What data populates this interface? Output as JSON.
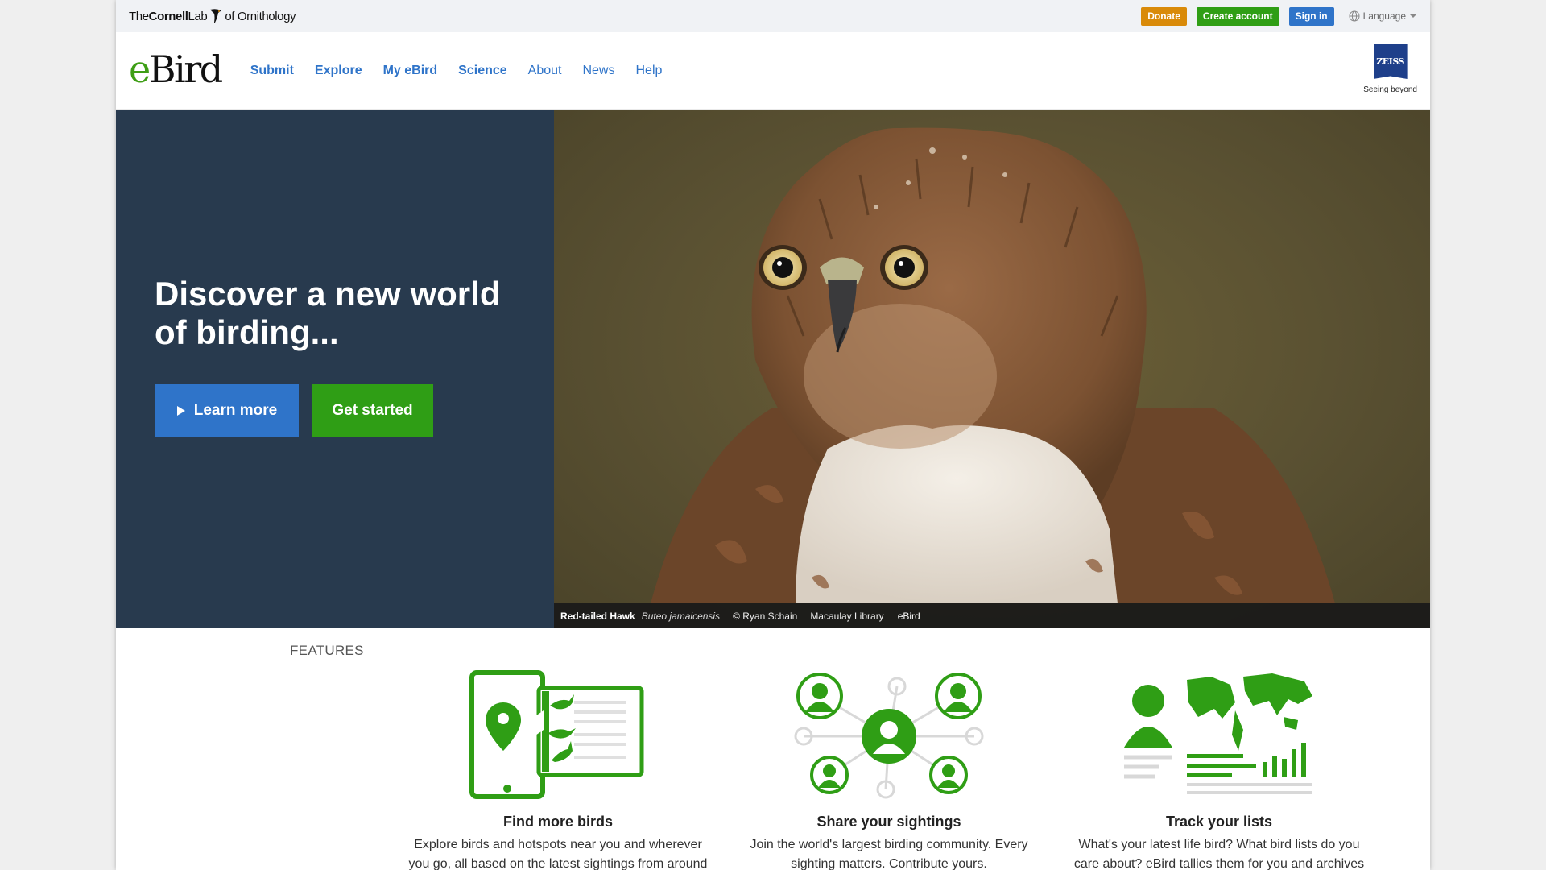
{
  "topbar": {
    "brand_the": "The",
    "brand_cornell": "Cornell",
    "brand_lab": "Lab",
    "brand_of": "of Ornithology",
    "donate": "Donate",
    "create_account": "Create account",
    "sign_in": "Sign in",
    "language": "Language"
  },
  "nav": {
    "logo_e": "e",
    "logo_rest": "Bird",
    "items": [
      {
        "label": "Submit"
      },
      {
        "label": "Explore"
      },
      {
        "label": "My eBird"
      },
      {
        "label": "Science"
      },
      {
        "label": "About"
      },
      {
        "label": "News"
      },
      {
        "label": "Help"
      }
    ],
    "sponsor_name": "ZEISS",
    "sponsor_tagline": "Seeing beyond"
  },
  "hero": {
    "title": "Discover a new world of birding...",
    "learn_more": "Learn more",
    "get_started": "Get started",
    "caption": {
      "common_name": "Red-tailed Hawk",
      "scientific_name": "Buteo jamaicensis",
      "credit": "© Ryan Schain",
      "source_1": "Macaulay Library",
      "source_2": "eBird"
    }
  },
  "features": {
    "heading": "FEATURES",
    "items": [
      {
        "title": "Find more birds",
        "text": "Explore birds and hotspots near you and wherever you go, all based on the latest sightings from around"
      },
      {
        "title": "Share your sightings",
        "text": "Join the world's largest birding community. Every sighting matters. Contribute yours."
      },
      {
        "title": "Track your lists",
        "text": "What's your latest life bird? What bird lists do you care about? eBird tallies them for you and archives"
      }
    ]
  },
  "colors": {
    "green": "#2f9e15",
    "blue": "#2f74c9",
    "orange": "#d98a09",
    "hero_dark": "#283a4e"
  }
}
